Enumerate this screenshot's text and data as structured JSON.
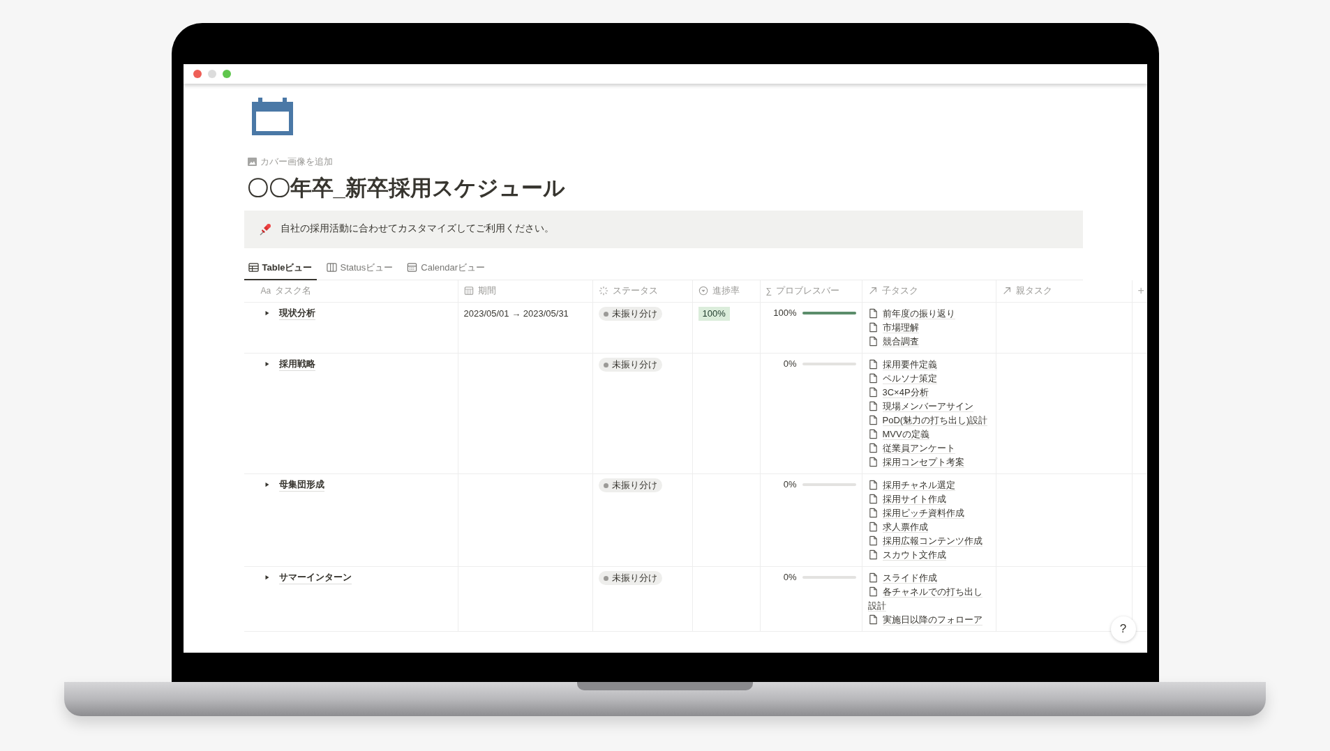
{
  "page": {
    "add_cover": "カバー画像を追加",
    "title": "〇〇年卒_新卒採用スケジュール",
    "callout": "自社の採用活動に合わせてカスタマイズしてご利用ください。"
  },
  "tabs": [
    {
      "label": "Tableビュー",
      "kind": "table",
      "selected": true
    },
    {
      "label": "Statusビュー",
      "kind": "board",
      "selected": false
    },
    {
      "label": "Calendarビュー",
      "kind": "calendar",
      "selected": false
    }
  ],
  "table": {
    "columns": [
      {
        "label": "タスク名",
        "kind": "title",
        "icon_text": "Aa"
      },
      {
        "label": "期間",
        "kind": "date"
      },
      {
        "label": "ステータス",
        "kind": "status"
      },
      {
        "label": "進捗率",
        "kind": "select"
      },
      {
        "label": "プロブレスバー",
        "kind": "formula",
        "icon_text": "∑"
      },
      {
        "label": "子タスク",
        "kind": "relation"
      },
      {
        "label": "親タスク",
        "kind": "relation"
      }
    ],
    "add_column": "+",
    "rows": [
      {
        "name": "現状分析",
        "period": "2023/05/01 → 2023/05/31",
        "status": "未振り分け",
        "progress_tag": "100%",
        "percent": "100%",
        "level": 1,
        "subtasks": [
          "前年度の振り返り",
          "市場理解",
          "競合調査"
        ]
      },
      {
        "name": "採用戦略",
        "status": "未振り分け",
        "percent": "0%",
        "level": 0,
        "subtasks": [
          "採用要件定義",
          "ペルソナ策定",
          "3C×4P分析",
          "現場メンバーアサイン",
          "PoD(魅力の打ち出し)設計",
          "MVVの定義",
          "従業員アンケート",
          "採用コンセプト考案"
        ]
      },
      {
        "name": "母集団形成",
        "status": "未振り分け",
        "percent": "0%",
        "level": 0,
        "subtasks": [
          "採用チャネル選定",
          "採用サイト作成",
          "採用ピッチ資料作成",
          "求人票作成",
          "採用広報コンテンツ作成",
          "スカウト文作成"
        ]
      },
      {
        "name": "サマーインターン",
        "status": "未振り分け",
        "percent": "0%",
        "level": 0,
        "subtasks": [
          "スライド作成",
          "各チャネルでの打ち出し設計",
          "実施日以降のフォローア"
        ]
      }
    ]
  },
  "help_button": "?"
}
